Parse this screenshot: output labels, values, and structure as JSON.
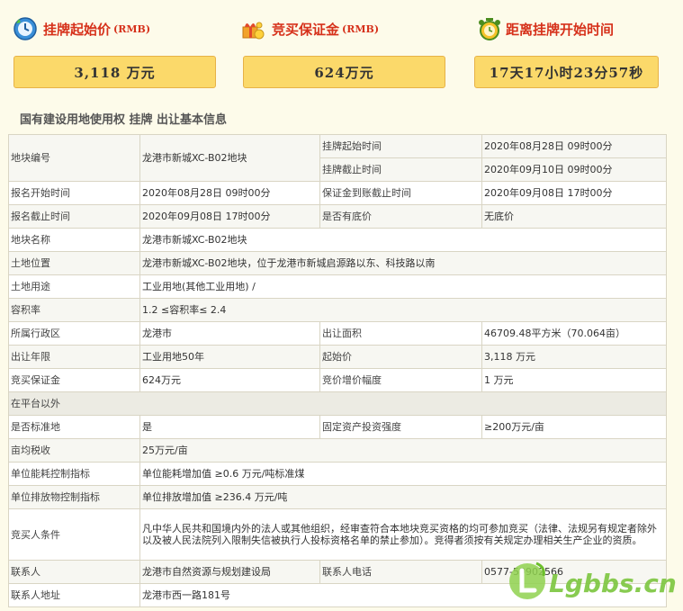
{
  "stats": [
    {
      "icon": "clock-refresh-icon",
      "title": "挂牌起始价",
      "unit": "(RMB)",
      "value": "3,118 万元"
    },
    {
      "icon": "gift-coins-icon",
      "title": "竞买保证金",
      "unit": "(RMB)",
      "value": "624万元"
    },
    {
      "icon": "alarm-clock-icon",
      "title": "距离挂牌开始时间",
      "unit": "",
      "value": "17天17小时23分57秒"
    }
  ],
  "section_title": "国有建设用地使用权 挂牌 出让基本信息",
  "table": {
    "land_no_label": "地块编号",
    "land_no": "龙港市新城XC-B02地块",
    "list_start_label": "挂牌起始时间",
    "list_start": "2020年08月28日 09时00分",
    "list_end_label": "挂牌截止时间",
    "list_end": "2020年09月10日 09时00分",
    "reg_start_label": "报名开始时间",
    "reg_start": "2020年08月28日 09时00分",
    "deposit_deadline_label": "保证金到账截止时间",
    "deposit_deadline": "2020年09月08日 17时00分",
    "reg_end_label": "报名截止时间",
    "reg_end": "2020年09月08日 17时00分",
    "reserve_label": "是否有底价",
    "reserve": "无底价",
    "name_label": "地块名称",
    "name": "龙港市新城XC-B02地块",
    "location_label": "土地位置",
    "location": "龙港市新城XC-B02地块，位于龙港市新城启源路以东、科技路以南",
    "use_label": "土地用途",
    "use": "工业用地(其他工业用地) /",
    "far_label": "容积率",
    "far": "1.2 ≤容积率≤ 2.4",
    "district_label": "所属行政区",
    "district": "龙港市",
    "area_label": "出让面积",
    "area": "46709.48平方米（70.064亩）",
    "term_label": "出让年限",
    "term": "工业用地50年",
    "start_price_label": "起始价",
    "start_price": "3,118 万元",
    "deposit_label": "竞买保证金",
    "deposit": "624万元",
    "increment_label": "竞价增价幅度",
    "increment": "1 万元",
    "platform_label": "在平台以外",
    "standard_label": "是否标准地",
    "standard": "是",
    "invest_label": "固定资产投资强度",
    "invest": "≥200万元/亩",
    "tax_label": "亩均税收",
    "tax": "25万元/亩",
    "energy_label": "单位能耗控制指标",
    "energy": "单位能耗增加值 ≥0.6 万元/吨标准煤",
    "emission_label": "单位排放物控制指标",
    "emission": "单位排放增加值 ≥236.4 万元/吨",
    "bidder_label": "竞买人条件",
    "bidder": "凡中华人民共和国境内外的法人或其他组织，经审查符合本地块竞买资格的均可参加竞买（法律、法规另有规定者除外以及被人民法院列入限制失信被执行人投标资格名单的禁止参加）。竞得者须按有关规定办理相关生产企业的资质。",
    "contact_label": "联系人",
    "contact": "龙港市自然资源与规划建设局",
    "phone_label": "联系人电话",
    "phone": "0577-59902566",
    "address_label": "联系人地址",
    "address": "龙港市西一路181号"
  },
  "watermark": "Lgbbs.cn"
}
